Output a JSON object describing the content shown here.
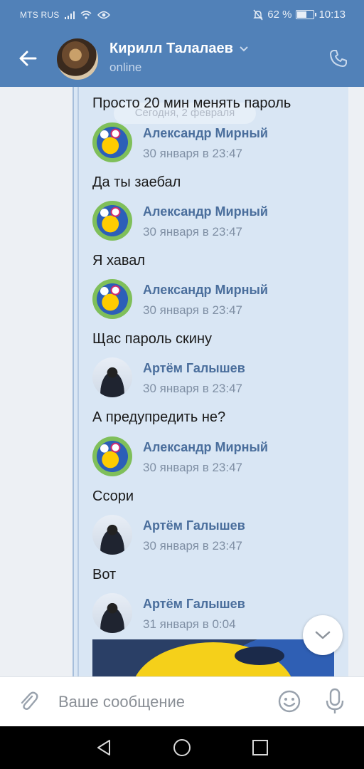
{
  "statusbar": {
    "carrier": "MTS RUS",
    "battery_percent": "62 %",
    "battery_level": 0.62,
    "time": "10:13"
  },
  "header": {
    "contact_name": "Кирилл Талалаев",
    "status": "online"
  },
  "chat": {
    "date_pill": "Сегодня, 2 февраля",
    "messages": [
      {
        "text": "Просто 20 мин менять пароль"
      },
      {
        "author": "Александр Мирный",
        "time": "30 января в 23:47",
        "avatar": "bird-avatar",
        "text": "Да ты заебал"
      },
      {
        "author": "Александр Мирный",
        "time": "30 января в 23:47",
        "avatar": "bird-avatar",
        "text": "Я хавал"
      },
      {
        "author": "Александр Мирный",
        "time": "30 января в 23:47",
        "avatar": "bird-avatar",
        "text": "Щас пароль скину"
      },
      {
        "author": "Артём Галышев",
        "time": "30 января в 23:47",
        "avatar": "person-avatar",
        "text": "А предупредить не?"
      },
      {
        "author": "Александр Мирный",
        "time": "30 января в 23:47",
        "avatar": "bird-avatar",
        "text": "Ссори"
      },
      {
        "author": "Артём Галышев",
        "time": "30 января в 23:47",
        "avatar": "person-avatar",
        "text": "Вот"
      },
      {
        "author": "Артём Галышев",
        "time": "31 января в 0:04",
        "avatar": "person-avatar"
      }
    ]
  },
  "composer": {
    "placeholder": "Ваше сообщение"
  },
  "icons": {
    "back": "arrow-left-icon",
    "call": "phone-icon",
    "attach": "paperclip-icon",
    "emoji": "smile-icon",
    "voice": "microphone-icon",
    "scroll_down": "chevron-down-icon"
  },
  "colors": {
    "header_bg": "#5181b8",
    "forwarded_bg": "#d9e6f4",
    "author_link": "#4a6e9c"
  }
}
